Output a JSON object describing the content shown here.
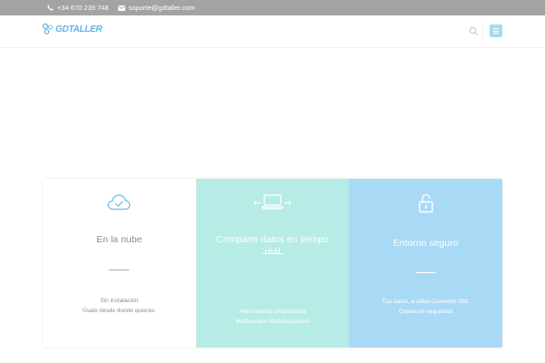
{
  "topbar": {
    "phone_icon": "phone-icon",
    "phone": "+34 670 239 748",
    "email_icon": "envelope-icon",
    "email": "soporte@gdtaller.com"
  },
  "header": {
    "logo_text": "GDTALLER",
    "search_icon": "search-icon",
    "menu_icon": "hamburger-menu-icon",
    "brand_color": "#5fb3e6",
    "menu_color": "#a9d8f3"
  },
  "features": [
    {
      "icon": "cloud-check-icon",
      "title": "En la nube",
      "lines": [
        "Sin instalación",
        "Úsalo desde donde quieras."
      ],
      "background": "#ffffff"
    },
    {
      "icon": "laptop-sync-icon",
      "title": "Comparte datos en tiempo real",
      "lines": [
        "Herramienta colaborativa",
        "Multiusuario Multidispositivo"
      ],
      "background": "#b7ebe5"
    },
    {
      "icon": "padlock-icon",
      "title": "Entorno seguro",
      "lines": [
        "Tus datos, a salvo Conexión SSL",
        "Copias de seguridad"
      ],
      "background": "#a9daf5"
    }
  ]
}
